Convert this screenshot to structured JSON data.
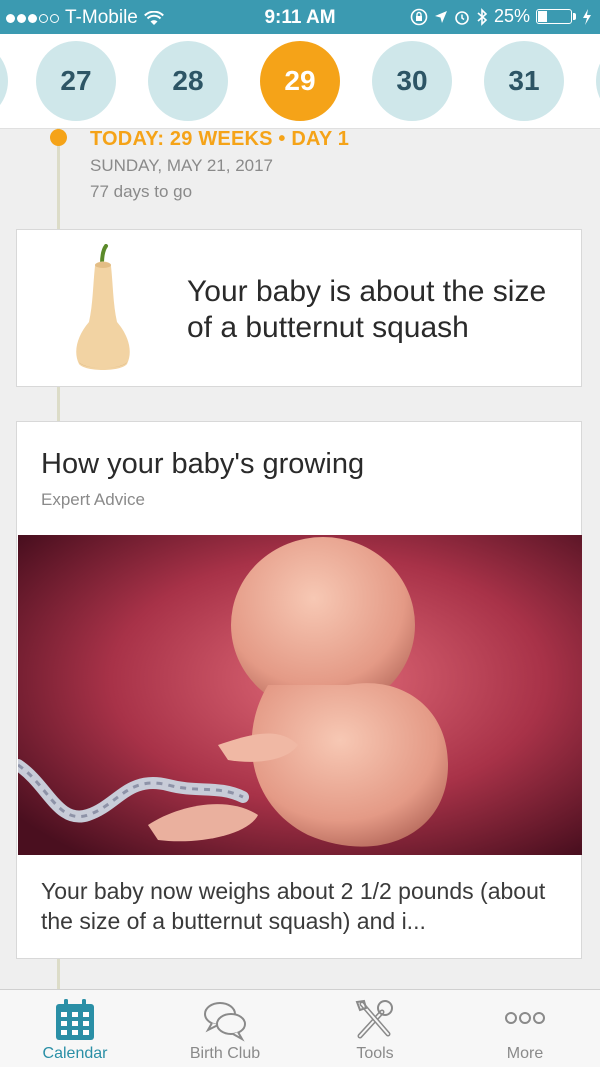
{
  "status_bar": {
    "carrier": "T-Mobile",
    "time": "9:11 AM",
    "battery": "25%",
    "battery_level": 0.25
  },
  "weeks": {
    "items": [
      "27",
      "28",
      "29",
      "30",
      "31"
    ],
    "selected": "29"
  },
  "today": {
    "title": "TODAY: 29 WEEKS • DAY 1",
    "date": "SUNDAY, MAY 21, 2017",
    "remaining": "77 days to go"
  },
  "size_card": {
    "text": "Your baby is about the size of a butternut squash",
    "icon": "butternut-squash-icon"
  },
  "article_card": {
    "title": "How your baby's growing",
    "subtitle": "Expert Advice",
    "excerpt": "Your baby now weighs about 2 1/2 pounds (about the size of a butternut squash) and i..."
  },
  "tabs": [
    {
      "label": "Calendar",
      "icon": "calendar-icon",
      "active": true
    },
    {
      "label": "Birth Club",
      "icon": "chat-bubbles-icon",
      "active": false
    },
    {
      "label": "Tools",
      "icon": "tools-icon",
      "active": false
    },
    {
      "label": "More",
      "icon": "more-icon",
      "active": false
    }
  ],
  "colors": {
    "status_bar": "#3b9ab1",
    "accent": "#f5a318",
    "week_circle": "#cfe7ea",
    "tab_active": "#2a8fa6"
  }
}
